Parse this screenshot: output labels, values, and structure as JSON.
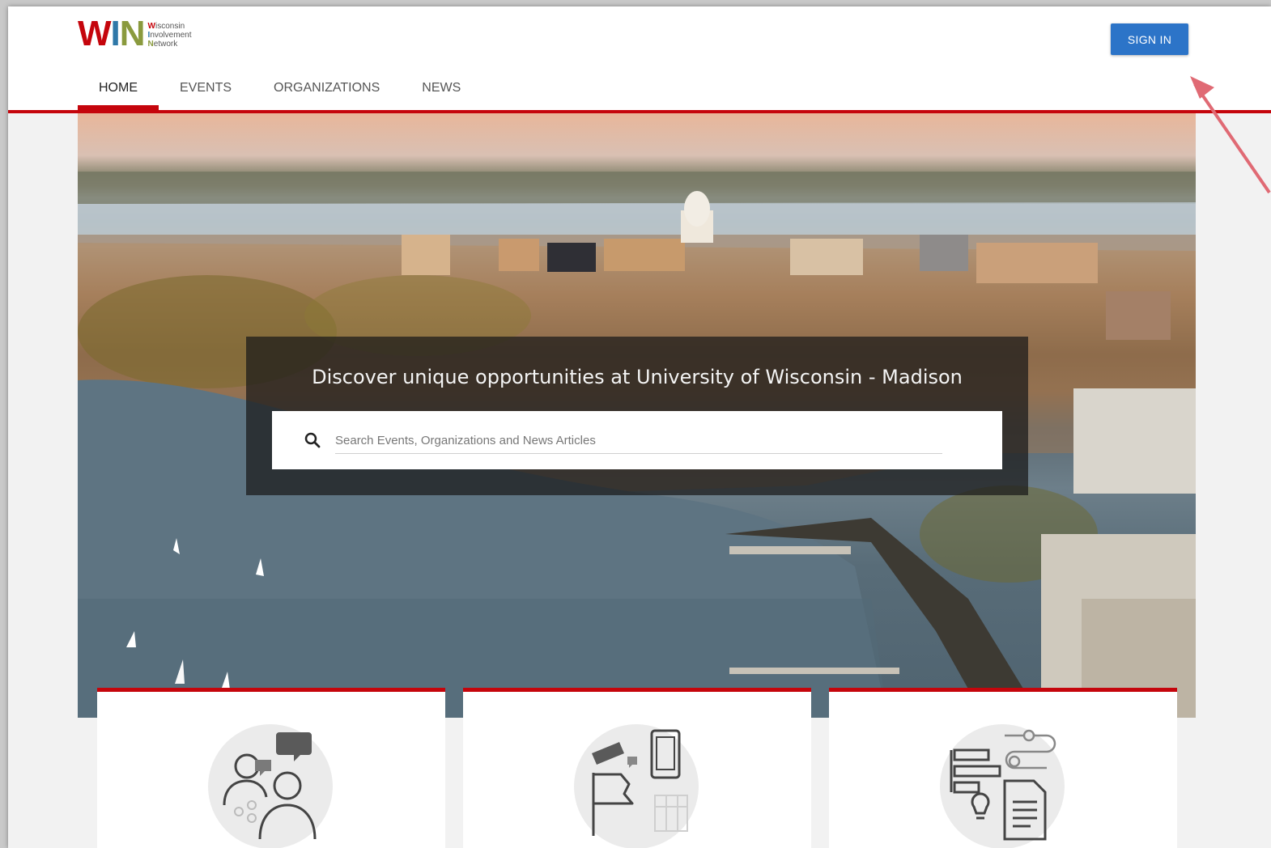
{
  "logo": {
    "letters": [
      "W",
      "I",
      "N"
    ],
    "lines": [
      {
        "initial": "W",
        "rest": "isconsin"
      },
      {
        "initial": "I",
        "rest": "nvolvement"
      },
      {
        "initial": "N",
        "rest": "etwork"
      }
    ]
  },
  "header": {
    "signin_label": "SIGN IN"
  },
  "nav": {
    "items": [
      {
        "label": "HOME",
        "active": true
      },
      {
        "label": "EVENTS",
        "active": false
      },
      {
        "label": "ORGANIZATIONS",
        "active": false
      },
      {
        "label": "NEWS",
        "active": false
      }
    ]
  },
  "hero": {
    "tagline": "Discover unique opportunities at University of Wisconsin - Madison",
    "search_placeholder": "Search Events, Organizations and News Articles",
    "search_value": ""
  },
  "cards": [
    {
      "icon": "people-chat-icon"
    },
    {
      "icon": "event-ticket-icon"
    },
    {
      "icon": "news-document-icon"
    }
  ],
  "colors": {
    "accent": "#c5050c",
    "button": "#2c74c8",
    "logo_w": "#c5050c",
    "logo_i": "#2f78a8",
    "logo_n": "#8a9a3e"
  }
}
